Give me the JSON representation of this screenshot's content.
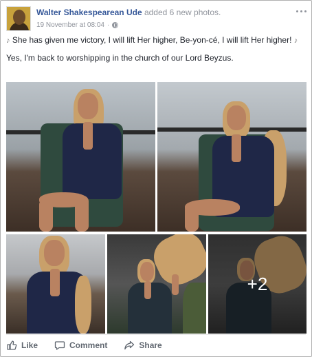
{
  "post": {
    "author": "Walter Shakespearean Ude",
    "action": " added 6 new photos.",
    "timestamp": "19 November at 08:04",
    "separator": "·",
    "paragraphs": [
      "She has given me victory, I will lift Her higher, Be-yon-cé, I will lift Her higher!",
      "Yes, I'm back to worshipping in the church of our Lord Beyzus."
    ],
    "more_photos_count": "+2"
  },
  "actions": {
    "like": "Like",
    "comment": "Comment",
    "share": "Share"
  },
  "colors": {
    "link": "#365899",
    "muted": "#90949c",
    "action": "#606770"
  },
  "icons": [
    "globe-icon",
    "more-icon",
    "music-note-icon",
    "like-icon",
    "comment-icon",
    "share-icon"
  ]
}
